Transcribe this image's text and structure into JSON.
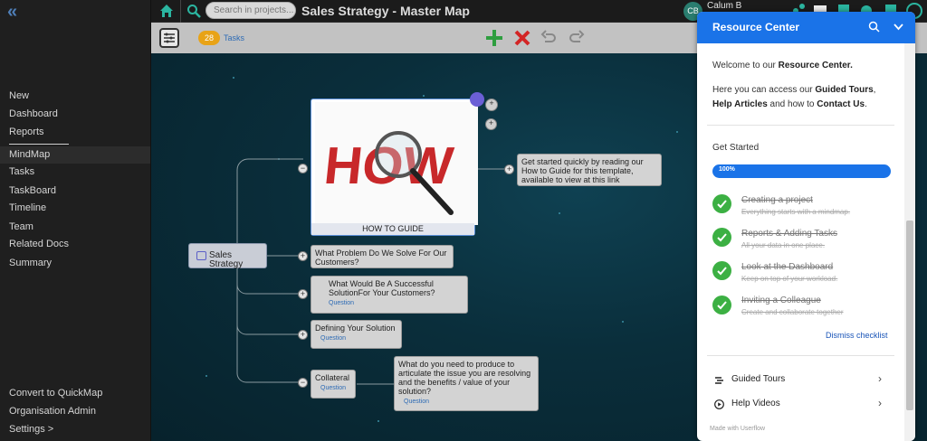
{
  "sidebar": {
    "items": [
      {
        "label": "New"
      },
      {
        "label": "Dashboard"
      },
      {
        "label": "Reports"
      },
      {
        "label": "MindMap"
      },
      {
        "label": "Tasks"
      },
      {
        "label": "TaskBoard"
      },
      {
        "label": "Timeline"
      },
      {
        "label": "Team"
      },
      {
        "label": "Related Docs"
      },
      {
        "label": "Summary"
      }
    ],
    "bottom": [
      {
        "label": "Convert to QuickMap"
      },
      {
        "label": "Organisation Admin"
      },
      {
        "label": "Settings >"
      }
    ],
    "active": "MindMap"
  },
  "header": {
    "search_placeholder": "Search in projects...",
    "title": "Sales Strategy - Master Map",
    "avatar_initials": "CB",
    "username": "Calum B"
  },
  "toolbar": {
    "tasks_count": "28",
    "tasks_label": "Tasks"
  },
  "mindmap": {
    "root": "Sales Strategy",
    "how_caption": "HOW TO GUIDE",
    "how_image_text": "HOW",
    "how_link_note": "Get started quickly by reading our How to Guide for this template, available to view at this link",
    "nodes": [
      {
        "text": "What Problem Do We Solve For Our Customers?"
      },
      {
        "text": "What Would Be A Successful SolutionFor Your Customers?",
        "tag": "Question"
      },
      {
        "text": "Defining Your Solution",
        "tag": "Question"
      },
      {
        "text": "Collateral",
        "tag": "Question"
      }
    ],
    "collateral_note": {
      "text": "What do you need to produce to articulate the issue you are resolving and the benefits / value of your solution?",
      "tag": "Question"
    }
  },
  "resource_center": {
    "title": "Resource Center",
    "welcome": "Welcome to our",
    "welcome_bold": "Resource Center.",
    "intro_pre": "Here you can access our",
    "intro_b1": "Guided Tours",
    "intro_b2": "Help Articles",
    "intro_mid": "and how to",
    "intro_b3": "Contact Us",
    "get_started": "Get Started",
    "progress_label": "100%",
    "progress": 1.0,
    "checklist": [
      {
        "title": "Creating a project",
        "sub": "Everything starts with a mindmap."
      },
      {
        "title": "Reports & Adding Tasks",
        "sub": "All your data in one place."
      },
      {
        "title": "Look at the Dashboard",
        "sub": "Keep on top of your workload."
      },
      {
        "title": "Inviting a Colleague",
        "sub": "Create and collaborate together"
      }
    ],
    "dismiss": "Dismiss checklist",
    "links": [
      {
        "label": "Guided Tours"
      },
      {
        "label": "Help Videos"
      }
    ],
    "footer": "Made with Userflow"
  },
  "colors": {
    "accent": "#1a73e8",
    "check": "#3cb043",
    "canvas": "#0a2e3b"
  }
}
